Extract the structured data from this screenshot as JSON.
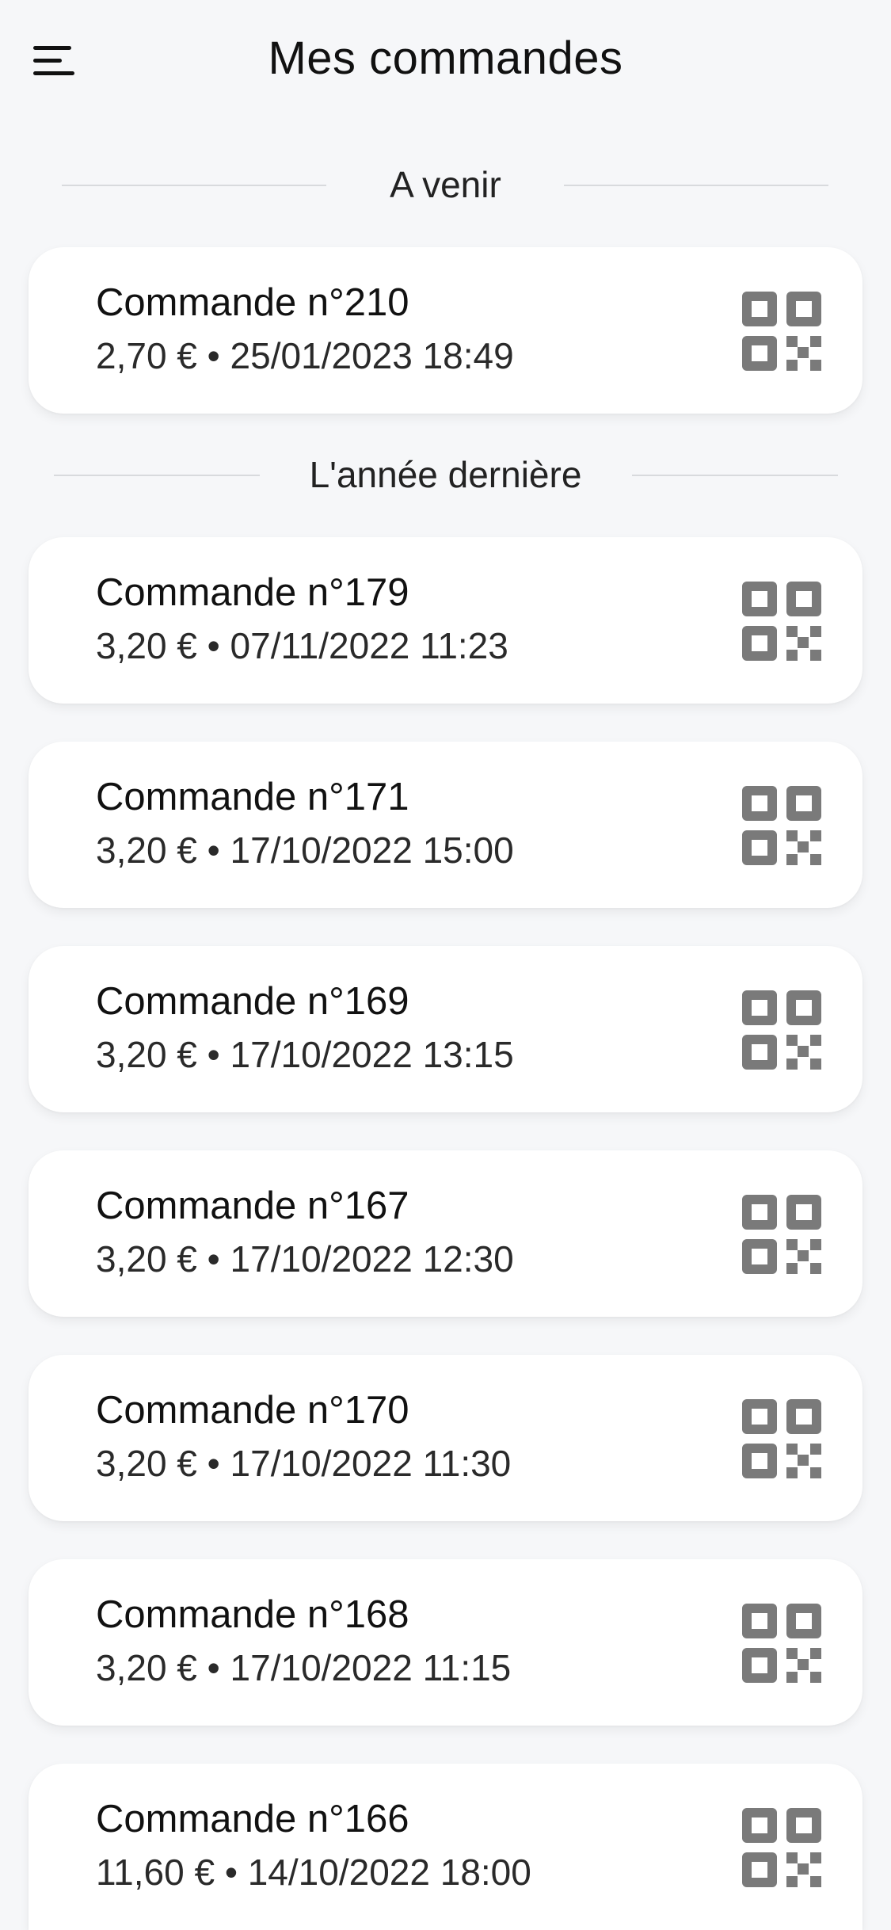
{
  "header": {
    "title": "Mes commandes",
    "menu_icon": "menu-icon"
  },
  "sections": [
    {
      "label": "A venir",
      "orders": [
        {
          "title": "Commande n°210",
          "meta": "2,70 € • 25/01/2023 18:49"
        }
      ]
    },
    {
      "label": "L'année dernière",
      "orders": [
        {
          "title": "Commande n°179",
          "meta": "3,20 € • 07/11/2022 11:23"
        },
        {
          "title": "Commande n°171",
          "meta": "3,20 € • 17/10/2022 15:00"
        },
        {
          "title": "Commande n°169",
          "meta": "3,20 € • 17/10/2022 13:15"
        },
        {
          "title": "Commande n°167",
          "meta": "3,20 € • 17/10/2022 12:30"
        },
        {
          "title": "Commande n°170",
          "meta": "3,20 € • 17/10/2022 11:30"
        },
        {
          "title": "Commande n°168",
          "meta": "3,20 € • 17/10/2022 11:15"
        },
        {
          "title": "Commande n°166",
          "meta": "11,60 € • 14/10/2022 18:00"
        }
      ]
    }
  ],
  "colors": {
    "background": "#f6f7f9",
    "card": "#ffffff",
    "icon": "#7a7a7a",
    "divider": "#d8dadd"
  },
  "icons": {
    "order_action": "qr-code-icon"
  }
}
